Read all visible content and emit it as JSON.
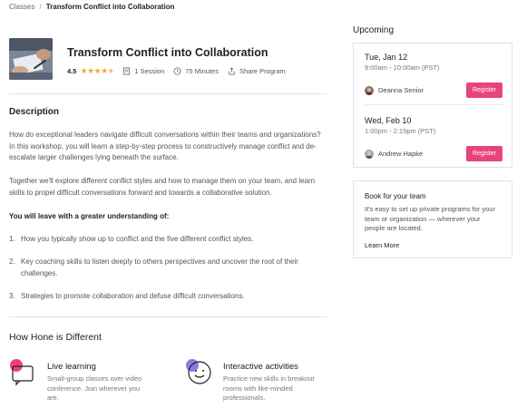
{
  "breadcrumb": {
    "parent": "Classes",
    "separator": "/",
    "current": "Transform Conflict into Collaboration"
  },
  "program": {
    "title": "Transform Conflict into Collaboration",
    "rating": "4.5",
    "stars_value": 4.5,
    "sessions": "1 Session",
    "duration": "75 Minutes",
    "share": "Share Program"
  },
  "description": {
    "heading": "Description",
    "p1": "How do exceptional leaders navigate difficult conversations within their teams and organizations? In this workshop, you will learn a step-by-step process to constructively manage conflict and de-escalate larger challenges lying beneath the surface.",
    "p2": "Together we'll explore different conflict styles and how to manage them on your team, and learn skills to propel difficult conversations forward and towards a collaborative solution.",
    "leave_heading": "You will leave with a greater understanding of:",
    "items": [
      {
        "num": "1.",
        "text": "How you typically show up to conflict and the five different conflict styles."
      },
      {
        "num": "2.",
        "text": "Key coaching skills to listen deeply to others perspectives and uncover the root of their challenges."
      },
      {
        "num": "3.",
        "text": "Strategies to promote collaboration and defuse difficult conversations."
      }
    ]
  },
  "hone": {
    "heading": "How Hone is Different",
    "features": [
      {
        "title": "Live learning",
        "desc": "Small-group classes over video conference. Join wherever you are."
      },
      {
        "title": "Interactive activities",
        "desc": "Practice new skills in breakout rooms with like-minded professionals."
      }
    ]
  },
  "upcoming": {
    "heading": "Upcoming",
    "sessions": [
      {
        "date": "Tue, Jan 12",
        "time": "9:00am - 10:00am (PST)",
        "host": "Deanna Senior",
        "register": "Register"
      },
      {
        "date": "Wed, Feb 10",
        "time": "1:00pm - 2:15pm (PST)",
        "host": "Andrew Hapke",
        "register": "Register"
      }
    ]
  },
  "team": {
    "title": "Book for your team",
    "desc": "It's easy to set up private programs for your team or organization — wherever your people are located.",
    "link": "Learn More"
  },
  "colors": {
    "accent": "#e8437c",
    "star": "#f2a43a",
    "feature_pink": "#e8437c",
    "feature_purple": "#8a7ce6"
  }
}
